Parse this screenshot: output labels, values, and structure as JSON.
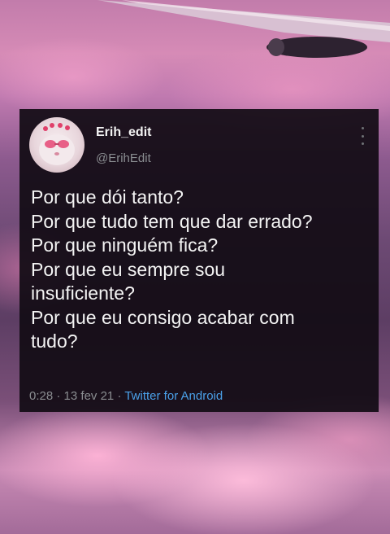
{
  "tweet": {
    "username": "Erih_edit",
    "handle": "@ErihEdit",
    "lines": [
      "Por que dói tanto?",
      "Por que tudo tem que dar errado?",
      "Por que ninguém fica?",
      "Por que eu sempre sou",
      "insuficiente?",
      "Por que eu consigo acabar com",
      "tudo?"
    ],
    "time": "0:28",
    "date": "13 fev 21",
    "source": "Twitter for Android",
    "separator": "·"
  },
  "icons": {
    "avatar": "avatar-cat-sunglasses-icon",
    "more": "more-options-icon",
    "background": "airplane-wing-over-pink-clouds"
  },
  "colors": {
    "card_bg": "#120c14",
    "text": "#f4f4f4",
    "muted": "#8a8d91",
    "link": "#4aa0e8"
  }
}
